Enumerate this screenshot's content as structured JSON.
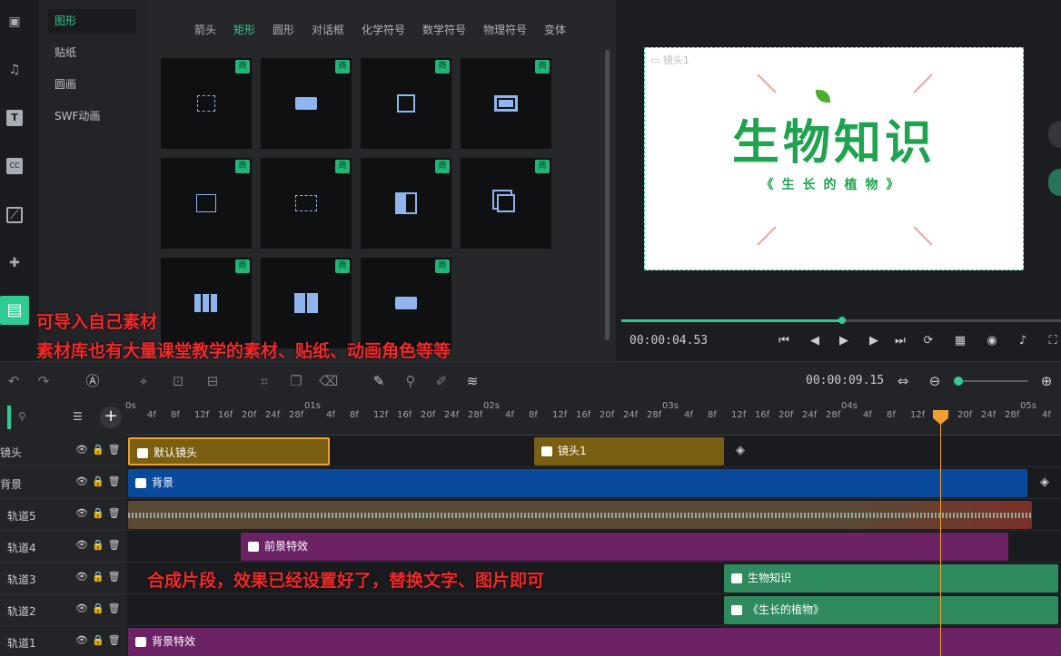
{
  "sidebar": {
    "icons": [
      "video-icon",
      "music-icon",
      "text-icon",
      "caption-icon",
      "effect-icon",
      "puzzle-icon",
      "folder-icon"
    ]
  },
  "categories": {
    "items": [
      "图形",
      "贴纸",
      "圆画",
      "SWF动画"
    ]
  },
  "library": {
    "tabs": [
      "箭头",
      "矩形",
      "圆形",
      "对话框",
      "化学符号",
      "数学符号",
      "物理符号",
      "变体"
    ],
    "badge": "商"
  },
  "preview": {
    "camera_label": "镜头1",
    "title": "生物知识",
    "subtitle": "《生长的植物》",
    "current_time": "00:00:04.53",
    "progress": 0.5
  },
  "overlay": {
    "line1": "可导入自己素材",
    "line2": "素材库也有大量课堂教学的素材、贴纸、动画角色等等",
    "line3": "合成片段，效果已经设置好了，替换文字、图片即可"
  },
  "toolbar": {
    "total_time": "00:00:09.15"
  },
  "timeline": {
    "ruler": {
      "seconds": [
        "0s",
        "01s",
        "02s",
        "03s",
        "04s",
        "05s"
      ],
      "frames": [
        "4f",
        "8f",
        "12f",
        "16f",
        "20f",
        "24f",
        "28f"
      ]
    },
    "tracks": [
      {
        "label": "镜头",
        "clips": [
          "默认镜头",
          "镜头1"
        ]
      },
      {
        "label": "背景",
        "clips": [
          "背景"
        ]
      },
      {
        "label": "轨道5",
        "clips": []
      },
      {
        "label": "轨道4",
        "clips": [
          "前景特效"
        ]
      },
      {
        "label": "轨道3",
        "clips": [
          "生物知识"
        ]
      },
      {
        "label": "轨道2",
        "clips": [
          "《生长的植物》"
        ]
      },
      {
        "label": "轨道1",
        "clips": [
          "背景特效"
        ]
      }
    ]
  },
  "colors": {
    "accent": "#2fcb92",
    "camera_clip": "#7a5f12",
    "background_clip": "#0a4a9c",
    "effect_clip": "#6b2366",
    "text_clip": "#2f8a5e",
    "playhead": "#f0a030",
    "overlay_text": "#ee2a2a"
  }
}
